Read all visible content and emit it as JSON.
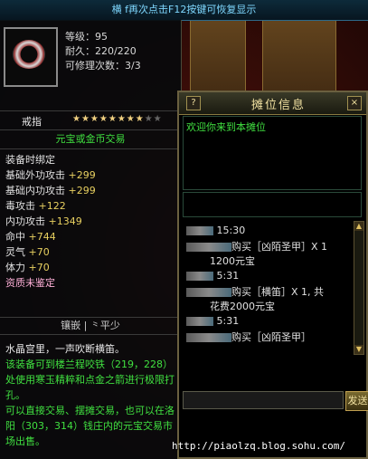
{
  "topbar": {
    "hint": "横 f再次点击F12按键可恢复显示"
  },
  "item": {
    "level": "等级：95",
    "durability": "耐久：220/220",
    "repair": "可修理次数：3/3",
    "name": "戒指",
    "stars_on": "★★★★★★★★",
    "stars_off": "★★",
    "trade": "元宝或金币交易",
    "bind": "装备时绑定",
    "attrs": [
      {
        "label": "基础外功攻击",
        "value": "+299"
      },
      {
        "label": "基础内功攻击",
        "value": "+299"
      },
      {
        "label": "毒攻击",
        "value": "+122"
      },
      {
        "label": "内功攻击",
        "value": "+1349"
      },
      {
        "label": "命中",
        "value": "+744"
      },
      {
        "label": "灵气",
        "value": "+70"
      },
      {
        "label": "体力",
        "value": "+70"
      }
    ],
    "unidentified": "资质未鉴定",
    "gem": "镶嵌 | ⺀平少",
    "desc_title": "水晶宫里，一声吹断横笛。",
    "desc_upgrade": "该装备可到楼兰程咬铁（219，228）处使用寒玉精粹和点金之箭进行极限打孔。",
    "desc_market": "可以直接交易、摆摊交易，也可以在洛阳（303，314）钱庄内的元宝交易市场出售。"
  },
  "stall": {
    "title": "摊位信息",
    "help_icon": "?",
    "close_icon": "×",
    "welcome": "欢迎你来到本摊位",
    "messages": [
      {
        "time": "15:30",
        "text": "购买［凶陌圣甲］X 1",
        "price": "1200元宝"
      },
      {
        "time": "5:31",
        "text": "购买［横笛］X 1, 共",
        "price": "花费2000元宝"
      },
      {
        "time": "5:31",
        "text": "购买［凶陌圣甲］",
        "price": ""
      }
    ],
    "send_label": "发送"
  },
  "watermark": "http://piaolzq.blog.sohu.com/"
}
